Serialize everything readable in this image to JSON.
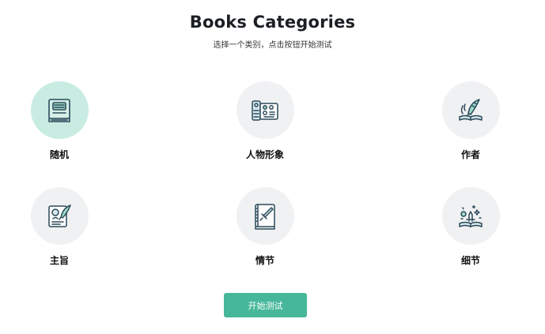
{
  "header": {
    "title": "Books Categories",
    "subtitle": "选择一个类别，点击按钮开始测试"
  },
  "categories": [
    {
      "label": "随机",
      "icon": "book-icon",
      "selected": true
    },
    {
      "label": "人物形象",
      "icon": "control-panel-icon",
      "selected": false
    },
    {
      "label": "作者",
      "icon": "quill-book-icon",
      "selected": false
    },
    {
      "label": "主旨",
      "icon": "portrait-quill-icon",
      "selected": false
    },
    {
      "label": "情节",
      "icon": "sword-book-icon",
      "selected": false
    },
    {
      "label": "细节",
      "icon": "magic-book-icon",
      "selected": false
    }
  ],
  "start_button": {
    "label": "开始测试"
  },
  "colors": {
    "accent": "#46b79a",
    "selected_bg": "#c9ece2",
    "circle_bg": "#f0f1f3",
    "icon_stroke": "#2b4a5a"
  }
}
